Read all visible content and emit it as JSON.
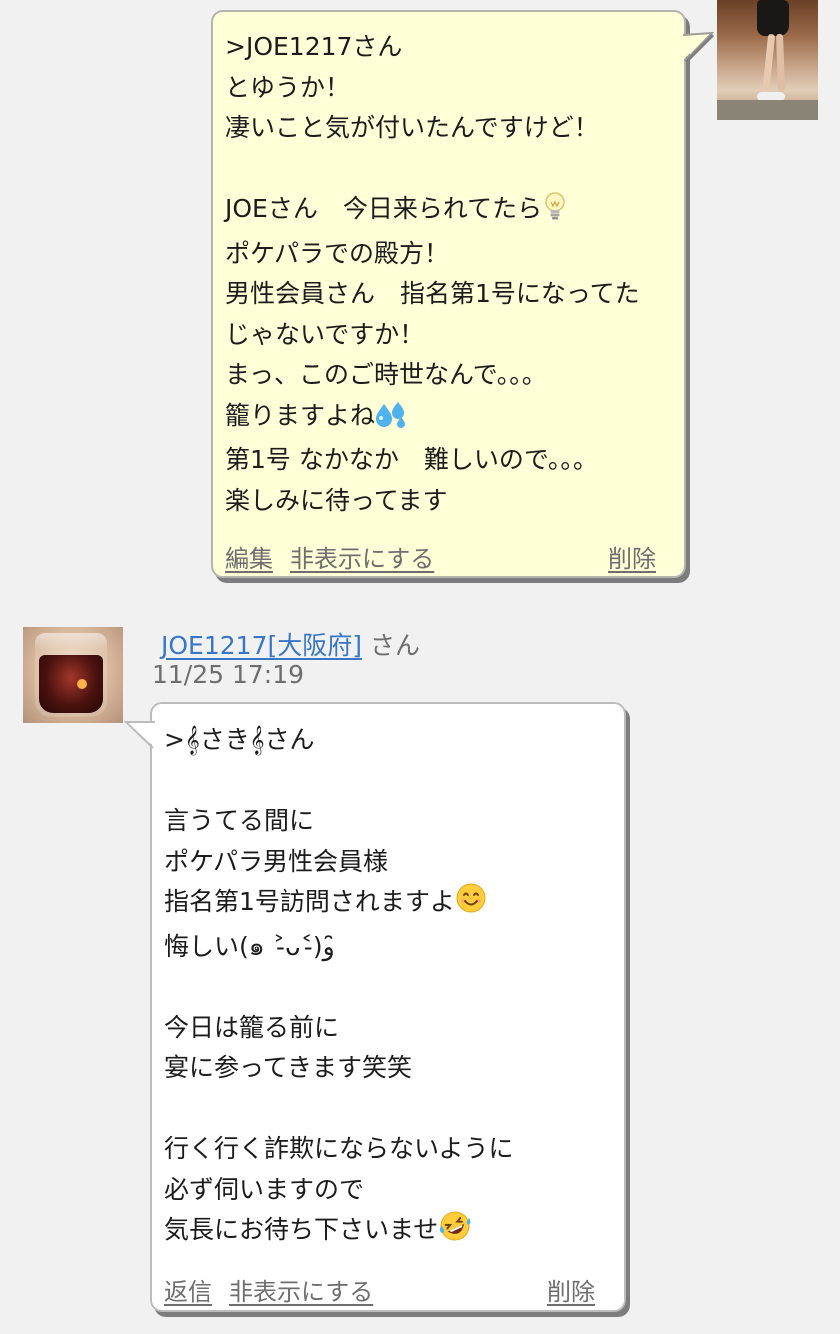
{
  "messages": [
    {
      "id": "own",
      "lines": [
        ">JOE1217さん",
        "とゆうか！",
        "凄いこと気が付いたんですけど！",
        "",
        "JOEさん　今日来られてたら",
        "ポケパラでの殿方！",
        "男性会員さん　指名第1号になってた",
        "じゃないですか！",
        "まっ、このご時世なんで。。。",
        "籠りますよね",
        "第1号 なかなか　難しいので。。。",
        "楽しみに待ってます"
      ],
      "actions": {
        "edit": "編集",
        "hide": "非表示にする",
        "delete": "削除"
      }
    },
    {
      "id": "reply",
      "username": "JOE1217[大阪府]",
      "username_suffix": "さん",
      "timestamp": "11/25 17:19",
      "lines": [
        ">𝄞さき𝄞さん",
        "",
        "言うてる間に",
        "ポケパラ男性会員様",
        "指名第1号訪問されますよ",
        "悔しい(๑ ˃̵ᴗ˂̵)و ̑̑",
        "",
        "今日は籠る前に",
        "宴に参ってきます笑笑",
        "",
        "行く行く詐欺にならないように",
        "必ず伺いますので",
        "気長にお待ち下さいませ"
      ],
      "actions": {
        "reply": "返信",
        "hide": "非表示にする",
        "delete": "削除"
      }
    }
  ],
  "icons": {
    "lightbulb": "lightbulb-emoji",
    "sweat": "sweat-droplets-emoji",
    "smile": "smiling-face-emoji",
    "rofl": "rolling-laughing-emoji"
  },
  "colors": {
    "own_bubble": "#ffffd8",
    "other_bubble": "#ffffff",
    "link": "#3877c7",
    "muted_text": "#6e6e6e",
    "background": "#f1f1f1"
  }
}
